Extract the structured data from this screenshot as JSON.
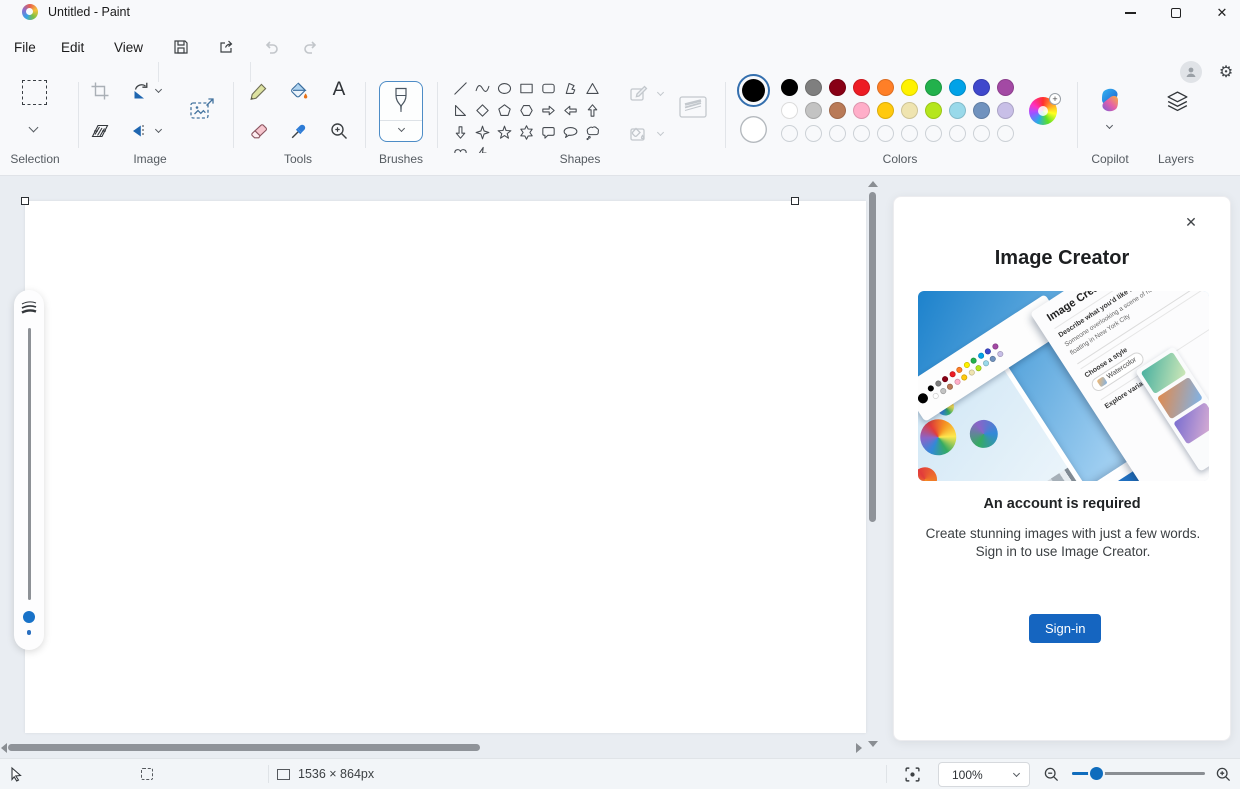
{
  "window": {
    "title": "Untitled - Paint"
  },
  "icons": {
    "close": "✕",
    "gear": "⚙",
    "text_tool": "A",
    "plus": "+"
  },
  "menu": {
    "items": [
      {
        "label": "File"
      },
      {
        "label": "Edit"
      },
      {
        "label": "View"
      }
    ]
  },
  "ribbon": {
    "groups": [
      {
        "label": "Selection"
      },
      {
        "label": "Image"
      },
      {
        "label": "Tools"
      },
      {
        "label": "Brushes"
      },
      {
        "label": "Shapes"
      },
      {
        "label": "Colors"
      },
      {
        "label": "Copilot"
      },
      {
        "label": "Layers"
      }
    ],
    "palette": {
      "color1": "#000000",
      "color2": "#FFFFFF",
      "row1": [
        "#000000",
        "#7F7F7F",
        "#880015",
        "#ED1C24",
        "#FF7F27",
        "#FFF200",
        "#22B14C",
        "#00A2E8",
        "#3F48CC",
        "#A349A4"
      ],
      "row2": [
        "#FFFFFF",
        "#C3C3C3",
        "#B97A57",
        "#FFAEC9",
        "#FFC90E",
        "#EFE4B0",
        "#B5E61D",
        "#99D9EA",
        "#7092BE",
        "#C8BFE7"
      ],
      "empty_slots": 10
    },
    "shapes": [
      "line",
      "curve",
      "ellipse",
      "rectangle",
      "rounded-rectangle",
      "polygon",
      "triangle",
      "right-triangle",
      "diamond",
      "pentagon",
      "hexagon",
      "arrow-right",
      "arrow-left",
      "arrow-up",
      "arrow-down",
      "star-4",
      "star-5",
      "star-6",
      "callout-round",
      "callout-oval",
      "callout-cloud",
      "heart",
      "lightning"
    ]
  },
  "image_creator": {
    "title": "Image Creator",
    "heading": "An account is required",
    "body": "Create stunning images with just a few words. Sign in to use Image Creator.",
    "signin_label": "Sign-in",
    "promo": {
      "title": "Image Creator",
      "describe_label": "Describe what you'd like to create",
      "prompt": "Someone overlooking a scene of hot air balloons floating in New York City",
      "style_label": "Choose a style",
      "style_value": "Watercolor",
      "variants_label": "Explore variants"
    }
  },
  "statusbar": {
    "canvas_size": "1536 × 864px",
    "zoom_value": "100%"
  },
  "accent": {
    "blue": "#1565C0"
  }
}
